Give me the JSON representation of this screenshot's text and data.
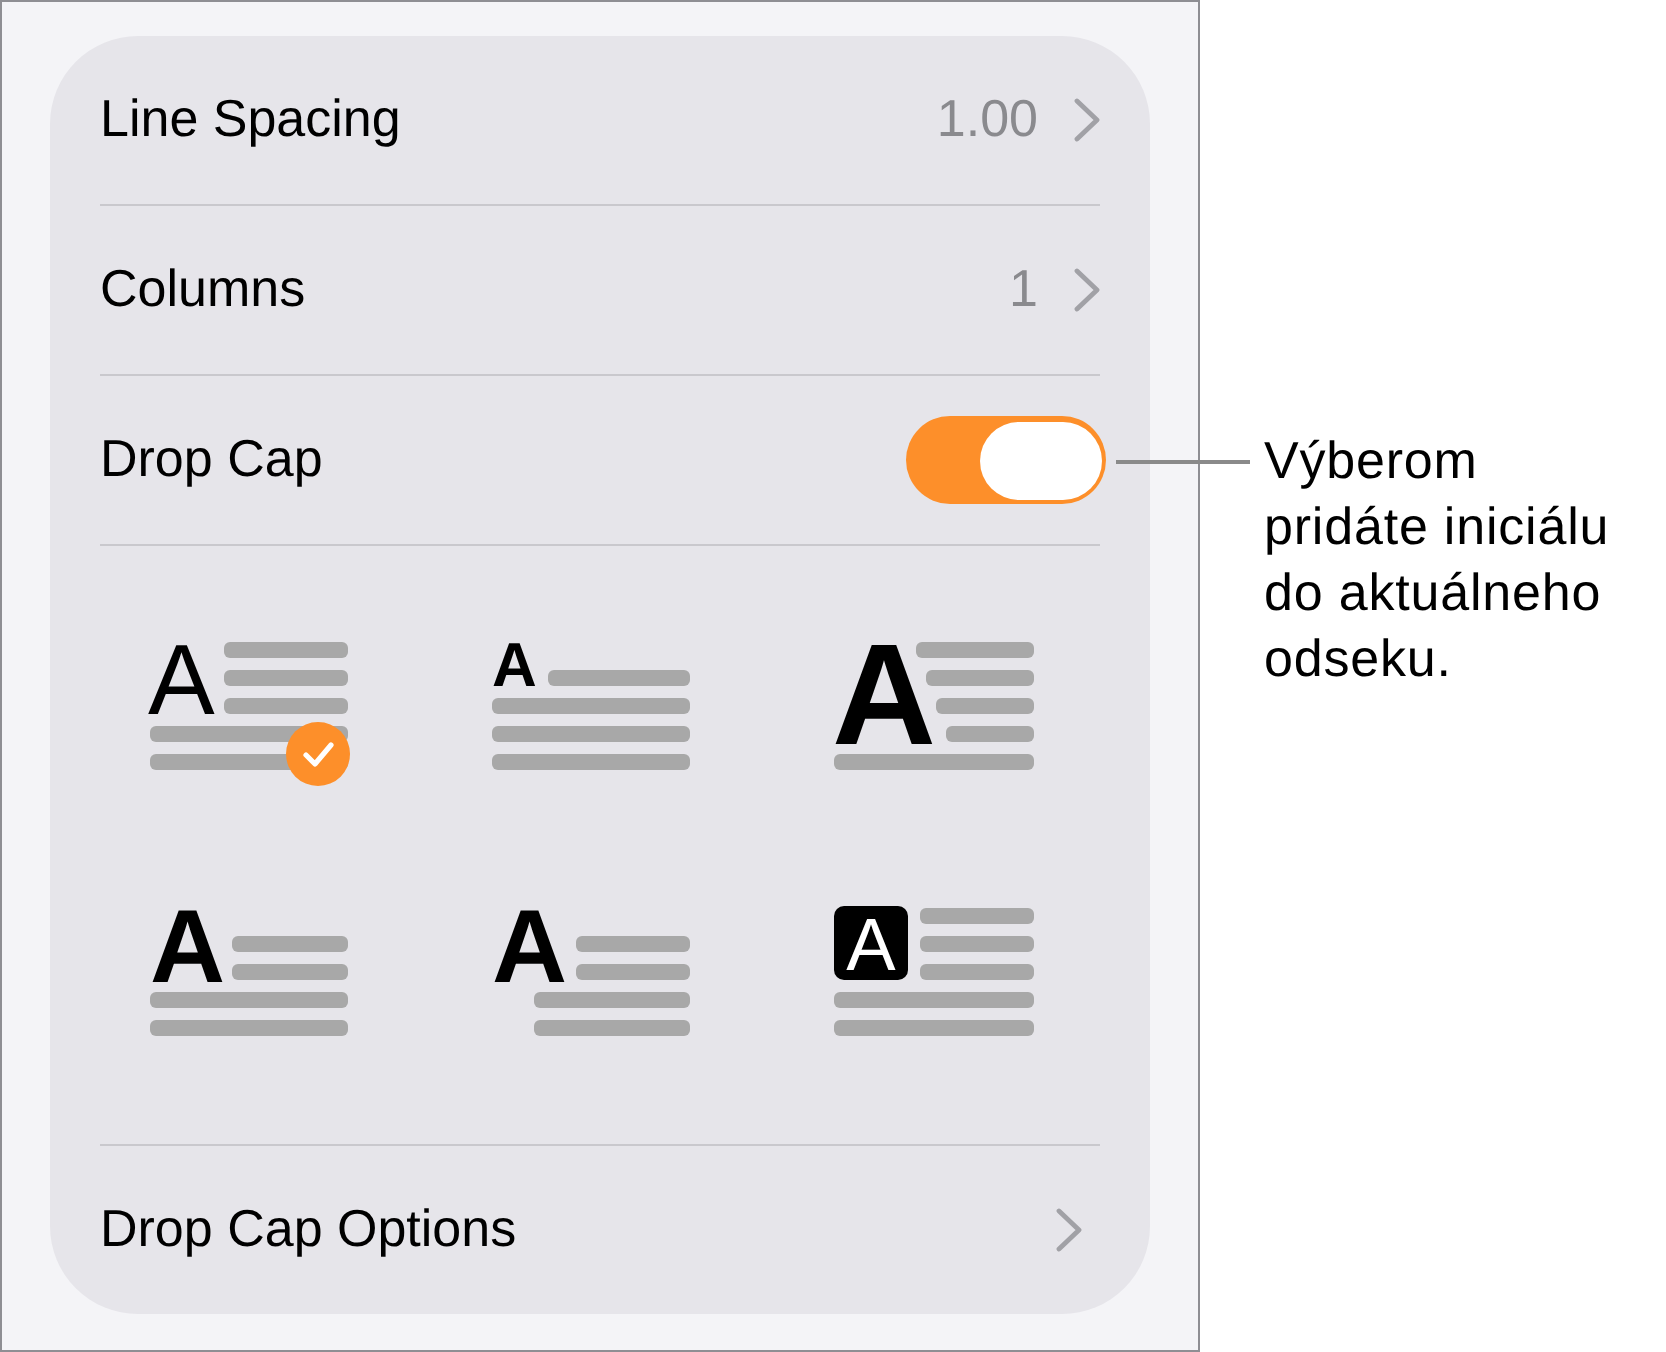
{
  "panel": {
    "rows": [
      {
        "kind": "value",
        "label": "Line Spacing",
        "value": "1.00"
      },
      {
        "kind": "value",
        "label": "Columns",
        "value": "1"
      },
      {
        "kind": "toggle",
        "label": "Drop Cap",
        "on": true
      }
    ],
    "drop_cap_styles": [
      {
        "kind": "light",
        "letter": "A",
        "selected": true
      },
      {
        "kind": "small",
        "letter": "A",
        "selected": false
      },
      {
        "kind": "large",
        "letter": "A",
        "selected": false
      },
      {
        "kind": "bold",
        "letter": "A",
        "selected": false
      },
      {
        "kind": "indented",
        "letter": "A",
        "selected": false
      },
      {
        "kind": "boxed",
        "letter": "A",
        "selected": false
      }
    ],
    "options_row": {
      "label": "Drop Cap Options"
    }
  },
  "callout": {
    "text": "Výberom pridáte iniciálu do aktuálneho odseku."
  }
}
